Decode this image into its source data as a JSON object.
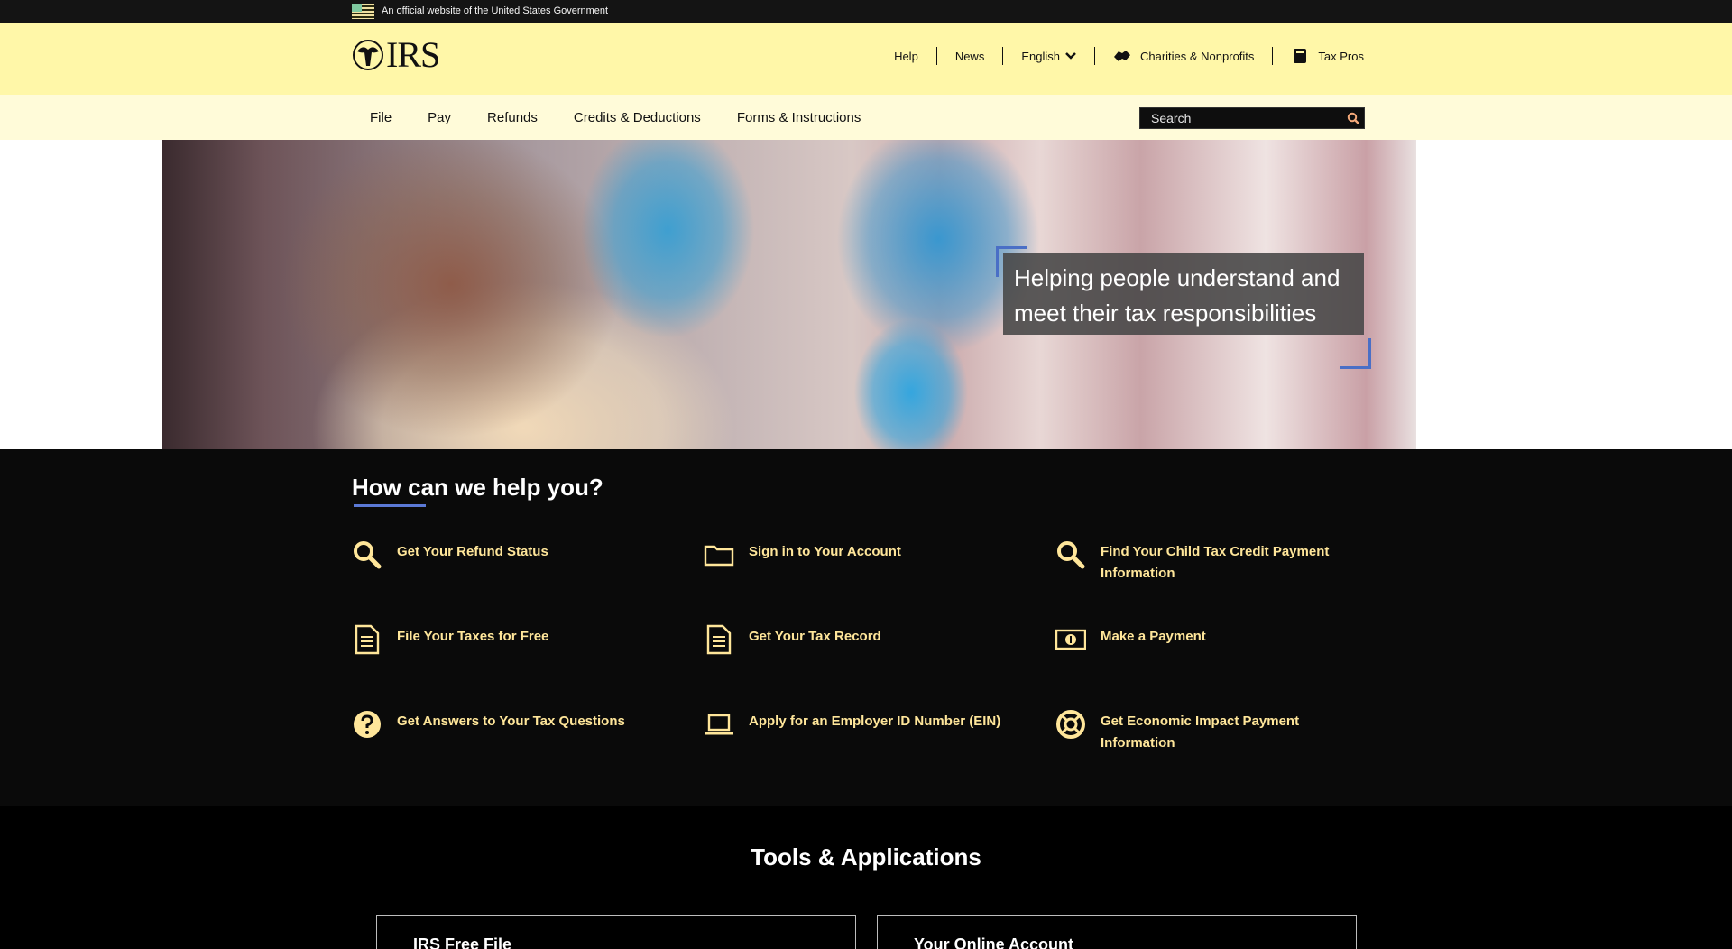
{
  "gov_banner": {
    "text": "An official website of the United States Government"
  },
  "header": {
    "logo_text": "IRS",
    "utility_nav": [
      {
        "label": "Help"
      },
      {
        "label": "News"
      },
      {
        "label": "English"
      },
      {
        "label": "Charities & Nonprofits"
      },
      {
        "label": "Tax Pros"
      }
    ]
  },
  "main_nav": {
    "items": [
      {
        "label": "File"
      },
      {
        "label": "Pay"
      },
      {
        "label": "Refunds"
      },
      {
        "label": "Credits & Deductions"
      },
      {
        "label": "Forms & Instructions"
      }
    ],
    "search_placeholder": "Search"
  },
  "hero": {
    "line1": "Helping people understand and",
    "line2": "meet their tax responsibilities"
  },
  "help": {
    "title": "How can we help you?",
    "items": [
      {
        "label": "Get Your Refund Status",
        "icon": "magnifier-icon"
      },
      {
        "label": "Sign in to Your Account",
        "icon": "folder-icon"
      },
      {
        "label": "Find Your Child Tax Credit Payment Information",
        "icon": "magnifier-icon"
      },
      {
        "label": "File Your Taxes for Free",
        "icon": "document-icon"
      },
      {
        "label": "Get Your Tax Record",
        "icon": "document-icon"
      },
      {
        "label": "Make a Payment",
        "icon": "money-icon"
      },
      {
        "label": "Get Answers to Your Tax Questions",
        "icon": "question-icon"
      },
      {
        "label": "Apply for an Employer ID Number (EIN)",
        "icon": "laptop-icon"
      },
      {
        "label": "Get Economic Impact Payment Information",
        "icon": "lifebuoy-icon"
      }
    ]
  },
  "tools": {
    "title": "Tools & Applications",
    "cards": [
      {
        "title": "IRS Free File"
      },
      {
        "title": "Your Online Account"
      }
    ]
  },
  "colors": {
    "header_bg": "#fff7a8",
    "nav_bg": "#fffbd9",
    "help_bg": "#0a0a0a",
    "help_link": "#ffe69a",
    "accent_blue": "#5b79d6"
  }
}
